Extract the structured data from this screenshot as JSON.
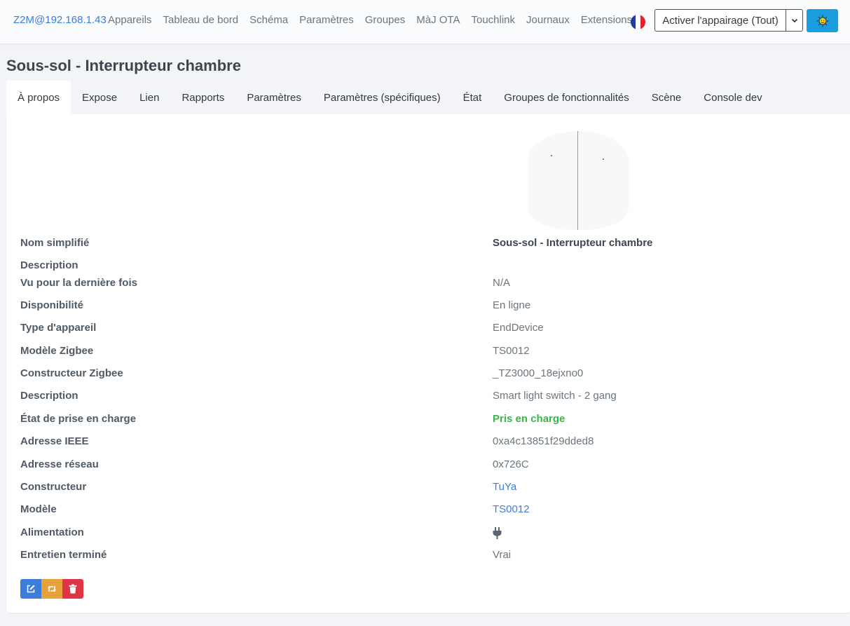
{
  "navbar": {
    "brand": "Z2M@192.168.1.43",
    "links": [
      "Appareils",
      "Tableau de bord",
      "Schéma",
      "Paramètres",
      "Groupes",
      "MàJ OTA",
      "Touchlink",
      "Journaux",
      "Extensions"
    ],
    "permit_join_label": "Activer l'appairage (Tout)",
    "flag_colors": [
      "#1f3c9e",
      "#ffffff",
      "#e0242f"
    ]
  },
  "page": {
    "title": "Sous-sol - Interrupteur chambre"
  },
  "tabs": [
    "À propos",
    "Expose",
    "Lien",
    "Rapports",
    "Paramètres",
    "Paramètres (spécifiques)",
    "État",
    "Groupes de fonctionnalités",
    "Scène",
    "Console dev"
  ],
  "details": [
    {
      "label": "Nom simplifié",
      "value": "Sous-sol - Interrupteur chambre"
    },
    {
      "label": "Description",
      "value": ""
    },
    {
      "label": "Vu pour la dernière fois",
      "value": "N/A"
    },
    {
      "label": "Disponibilité",
      "value": "En ligne"
    },
    {
      "label": "Type d'appareil",
      "value": "EndDevice"
    },
    {
      "label": "Modèle Zigbee",
      "value": "TS0012"
    },
    {
      "label": "Constructeur Zigbee",
      "value": "_TZ3000_18ejxno0"
    },
    {
      "label": "Description",
      "value": "Smart light switch - 2 gang"
    },
    {
      "label": "État de prise en charge",
      "value": "Pris en charge"
    },
    {
      "label": "Adresse IEEE",
      "value": "0xa4c13851f29dded8"
    },
    {
      "label": "Adresse réseau",
      "value": "0x726C"
    },
    {
      "label": "Constructeur",
      "value": "TuYa"
    },
    {
      "label": "Modèle",
      "value": "TS0012"
    },
    {
      "label": "Alimentation",
      "value": ""
    },
    {
      "label": "Entretien terminé",
      "value": "Vrai"
    }
  ],
  "icons": {
    "power": "plug-icon",
    "actions": [
      "edit-icon",
      "rename-icon",
      "trash-icon"
    ],
    "theme": "sun-icon",
    "dropdown": "chevron-down-icon"
  },
  "colors": {
    "accent": "#3b7ddd",
    "success": "#3bb44a",
    "warning": "#e7a23c",
    "danger": "#dc3545",
    "theme_button": "#1a9ee0"
  }
}
